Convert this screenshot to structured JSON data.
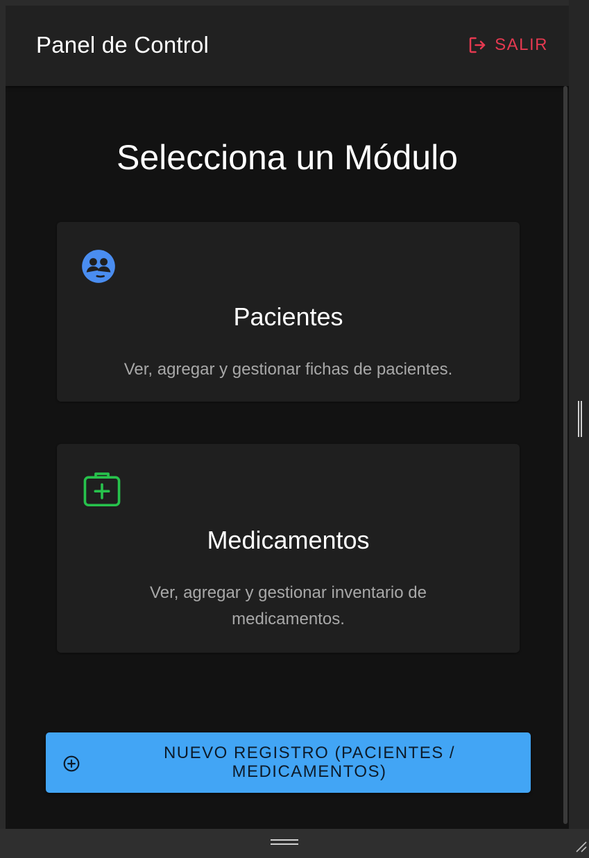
{
  "header": {
    "title": "Panel de Control",
    "logout_label": "SALIR"
  },
  "main": {
    "heading": "Selecciona un Módulo",
    "modules": [
      {
        "icon": "patients-group-icon",
        "title": "Pacientes",
        "description": "Ver, agregar y gestionar fichas de pacientes."
      },
      {
        "icon": "medical-kit-icon",
        "title": "Medicamentos",
        "description": "Ver, agregar y gestionar inventario de medicamentos."
      }
    ],
    "new_record_label": "NUEVO REGISTRO (PACIENTES / MEDICAMENTOS)"
  },
  "colors": {
    "logout": "#e53950",
    "patients_icon": "#4a8df0",
    "meds_icon": "#27c24c",
    "primary_button": "#42a5f5"
  }
}
